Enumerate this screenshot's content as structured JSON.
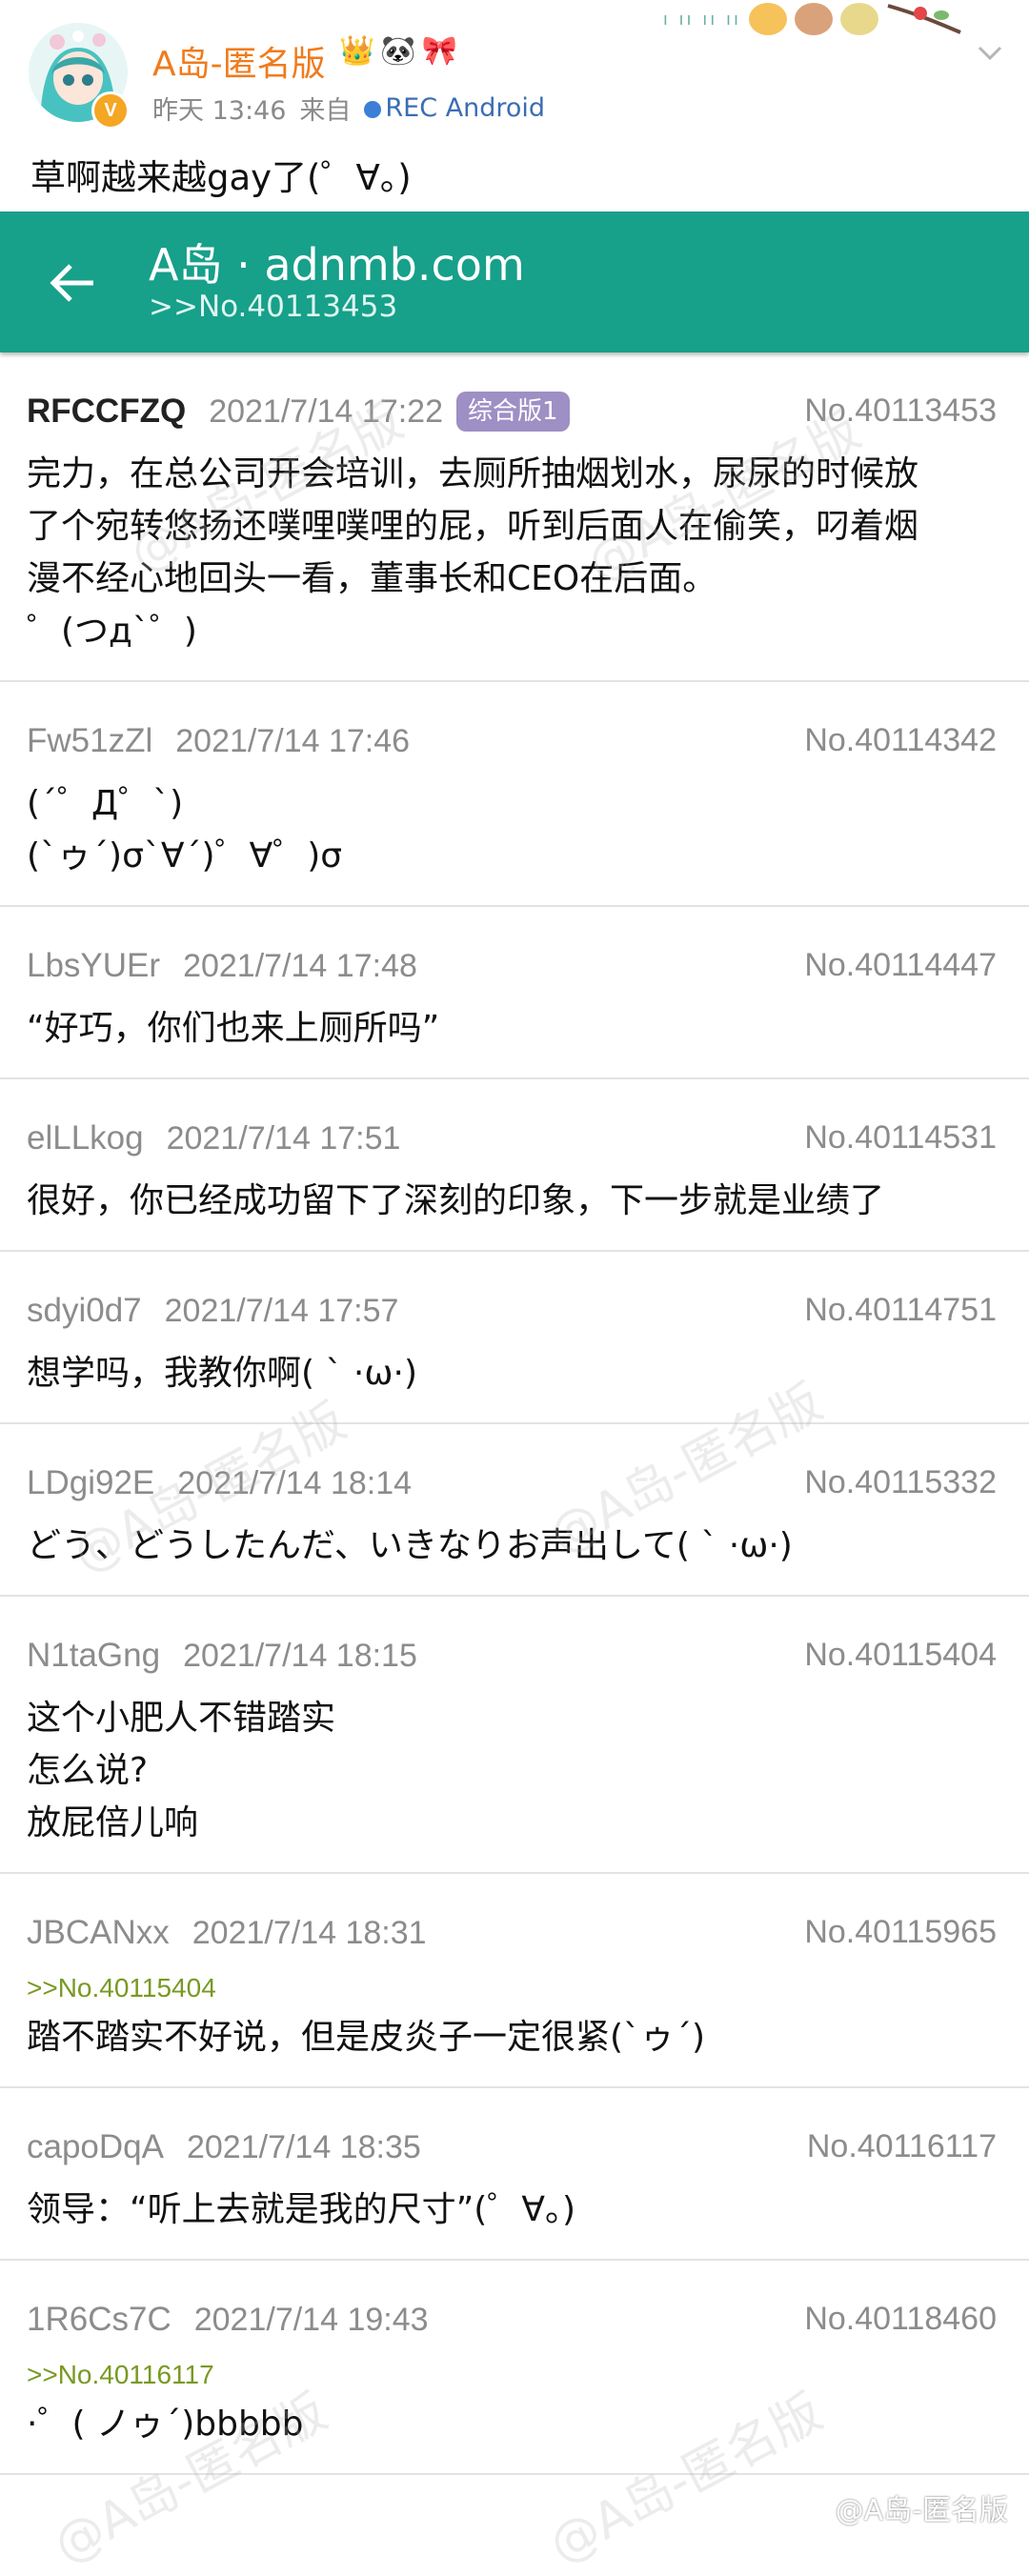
{
  "weibo": {
    "name": "A岛-匿名版",
    "name_emoji": [
      "👑",
      "🐼",
      "🎀"
    ],
    "time": "昨天 13:46",
    "from_label": "来自",
    "source": "REC  Android",
    "text": "草啊越来越gay了(゜∀。)",
    "verified_badge": "V"
  },
  "appbar": {
    "title": "A岛 · adnmb.com",
    "subtitle": ">>No.40113453",
    "accent_color": "#17a08a"
  },
  "replies": [
    {
      "user": "RFCCFZQ",
      "time": "2021/7/14 17:22",
      "tag": "综合版1",
      "no": "No.40113453",
      "quote": "",
      "body": "完力，在总公司开会培训，去厕所抽烟划水，尿尿的时候放\n了个宛转悠扬还噗哩噗哩的屁，听到后面人在偷笑，叼着烟\n漫不经心地回头一看，董事长和CEO在后面。\n゜(つд`゜)"
    },
    {
      "user": "Fw51zZl",
      "time": "2021/7/14 17:46",
      "tag": "",
      "no": "No.40114342",
      "quote": "",
      "body": "(´゜Д゜`)\n(`ゥ´)σ`∀´)゜∀゜)σ"
    },
    {
      "user": "LbsYUEr",
      "time": "2021/7/14 17:48",
      "tag": "",
      "no": "No.40114447",
      "quote": "",
      "body": "“好巧，你们也来上厕所吗”"
    },
    {
      "user": "elLLkog",
      "time": "2021/7/14 17:51",
      "tag": "",
      "no": "No.40114531",
      "quote": "",
      "body": "很好，你已经成功留下了深刻的印象，下一步就是业绩了"
    },
    {
      "user": "sdyi0d7",
      "time": "2021/7/14 17:57",
      "tag": "",
      "no": "No.40114751",
      "quote": "",
      "body": "想学吗，我教你啊( ` ·ω·)"
    },
    {
      "user": "LDgi92E",
      "time": "2021/7/14 18:14",
      "tag": "",
      "no": "No.40115332",
      "quote": "",
      "body": "どう、どうしたんだ、いきなりお声出して( ` ·ω·)"
    },
    {
      "user": "N1taGng",
      "time": "2021/7/14 18:15",
      "tag": "",
      "no": "No.40115404",
      "quote": "",
      "body": "这个小肥人不错踏实\n怎么说?\n放屁倍儿响"
    },
    {
      "user": "JBCANxx",
      "time": "2021/7/14 18:31",
      "tag": "",
      "no": "No.40115965",
      "quote": ">>No.40115404",
      "body": "踏不踏实不好说，但是皮炎子一定很紧(`ゥ´)"
    },
    {
      "user": "capoDqA",
      "time": "2021/7/14 18:35",
      "tag": "",
      "no": "No.40116117",
      "quote": "",
      "body": "领导：“听上去就是我的尺寸”(゜∀。)"
    },
    {
      "user": "1R6Cs7C",
      "time": "2021/7/14 19:43",
      "tag": "",
      "no": "No.40118460",
      "quote": ">>No.40116117",
      "body": "·゜( ノゥ´)bbbbb"
    }
  ],
  "watermark": "@A岛-匿名版"
}
